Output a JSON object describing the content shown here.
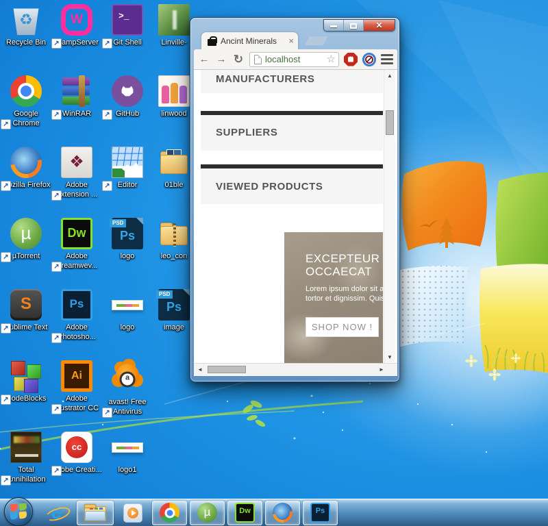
{
  "desktop": {
    "icons": [
      {
        "name": "recycle-bin",
        "label": "Recycle Bin"
      },
      {
        "name": "wampserver",
        "label": "WampServer"
      },
      {
        "name": "git-shell",
        "label": "Git Shell"
      },
      {
        "name": "linville",
        "label": "Linville-"
      },
      {
        "name": "google-chrome",
        "label": "Google Chrome"
      },
      {
        "name": "winrar",
        "label": "WinRAR"
      },
      {
        "name": "github",
        "label": "GitHub"
      },
      {
        "name": "linwood",
        "label": "linwood"
      },
      {
        "name": "mozilla-firefox",
        "label": "Mozilla Firefox"
      },
      {
        "name": "adobe-extension",
        "label": "Adobe Extension ..."
      },
      {
        "name": "editor",
        "label": "Editor"
      },
      {
        "name": "01ble",
        "label": "01ble"
      },
      {
        "name": "utorrent",
        "label": "µTorrent"
      },
      {
        "name": "adobe-dreamweaver",
        "label": "Adobe Dreamwev..."
      },
      {
        "name": "logo-psd",
        "label": "logo"
      },
      {
        "name": "leo-con",
        "label": "leo_con"
      },
      {
        "name": "sublime-text",
        "label": "Sublime Text"
      },
      {
        "name": "adobe-photoshop",
        "label": "Adobe Photosho..."
      },
      {
        "name": "logo-thumb",
        "label": "logo"
      },
      {
        "name": "image-psd",
        "label": "image"
      },
      {
        "name": "codeblocks",
        "label": "CodeBlocks"
      },
      {
        "name": "adobe-illustrator",
        "label": "Adobe Illustrator CC"
      },
      {
        "name": "avast",
        "label": "avast! Free Antivirus"
      },
      {
        "name": "total-annihilation",
        "label": "Total Annihilation"
      },
      {
        "name": "adobe-creative",
        "label": "Adobe Creati..."
      },
      {
        "name": "logo1",
        "label": "logo1"
      }
    ]
  },
  "window": {
    "tab_title": "Ancint Minerals",
    "url": "localhost",
    "page": {
      "sections": [
        "MANUFACTURERS",
        "SUPPLIERS",
        "VIEWED PRODUCTS"
      ],
      "banner": {
        "title_line1": "EXCEPTEUR",
        "title_line2": "OCCAECAT",
        "body_line1": "Lorem ipsum dolor sit amet",
        "body_line2": "tortor et dignissim. Quisque",
        "cta": "SHOP NOW !"
      }
    }
  },
  "icons": {
    "back": "←",
    "forward": "→",
    "reload": "↻",
    "star": "☆",
    "tab_close": "×",
    "win_close": "✕",
    "scroll_up": "▲",
    "scroll_down": "▼",
    "scroll_left": "◄",
    "scroll_right": "►",
    "recycle": "♻"
  },
  "icon_glyphs": {
    "wamp_w": "W",
    "gitshell_prompt": ">_",
    "adobe_ext_diamond": "❖",
    "utorrent_mu": "µ",
    "dreamweaver": "Dw",
    "photoshop": "Ps",
    "psd_tag": "PSD",
    "sublime_s": "S",
    "illustrator": "Ai",
    "creative_cloud": "cc",
    "ie_e": "e"
  },
  "taskbar": {
    "items": [
      "Start",
      "Internet Explorer",
      "Windows Explorer",
      "Windows Media Player",
      "Google Chrome",
      "uTorrent",
      "Adobe Dreamweaver",
      "Mozilla Firefox",
      "Adobe Photoshop"
    ]
  },
  "colors": {
    "wallpaper_blue": "#1b8ce0",
    "aero_glass": "#7fa9d2",
    "toolbar_cream": "#f6f4f0",
    "section_grey": "#f5f5f5",
    "separator_dark": "#2d2d2d",
    "banner_taupe": "#988c7d",
    "heading_text": "#555555",
    "url_green": "#48703f"
  }
}
